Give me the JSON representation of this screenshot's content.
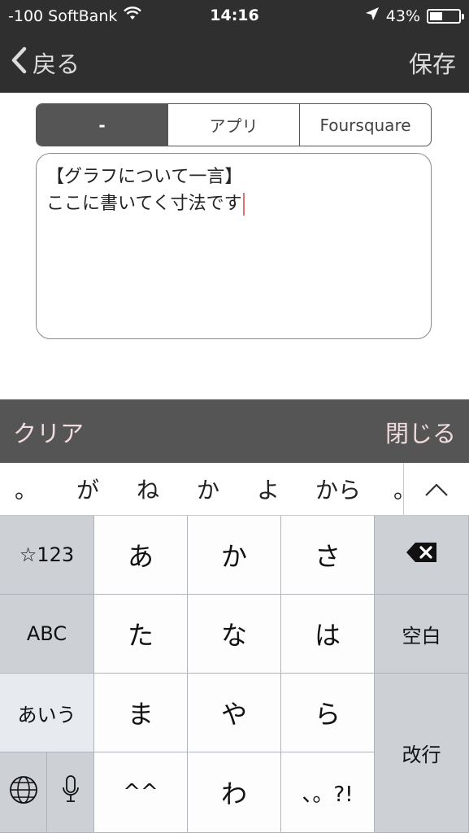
{
  "status_bar": {
    "carrier": "-100 SoftBank",
    "time": "14:16",
    "battery_text": "43%",
    "battery_level": 0.43
  },
  "nav": {
    "back_label": "戻る",
    "save_label": "保存"
  },
  "segments": [
    {
      "label": "-",
      "selected": true
    },
    {
      "label": "アプリ",
      "selected": false
    },
    {
      "label": "Foursquare",
      "selected": false
    }
  ],
  "note": {
    "line1": "【グラフについて一言】",
    "line2": "ここに書いてく寸法です"
  },
  "accessory": {
    "clear_label": "クリア",
    "close_label": "閉じる"
  },
  "candidates": [
    "。",
    "が",
    "ね",
    "か",
    "よ",
    "から",
    "。"
  ],
  "keyboard": {
    "symbols_label": "☆123",
    "abc_label": "ABC",
    "kana_mode_label": "あいう",
    "row1": [
      "あ",
      "か",
      "さ"
    ],
    "row2": [
      "た",
      "な",
      "は"
    ],
    "row3": [
      "ま",
      "や",
      "ら"
    ],
    "row4_emoticon": "^^",
    "row4_wa": "わ",
    "row4_punct": "、。?!",
    "space_label": "空白",
    "return_label": "改行"
  },
  "colors": {
    "bar_dark": "#2f2f2f",
    "accessory": "#555555",
    "caret": "#e37070"
  }
}
